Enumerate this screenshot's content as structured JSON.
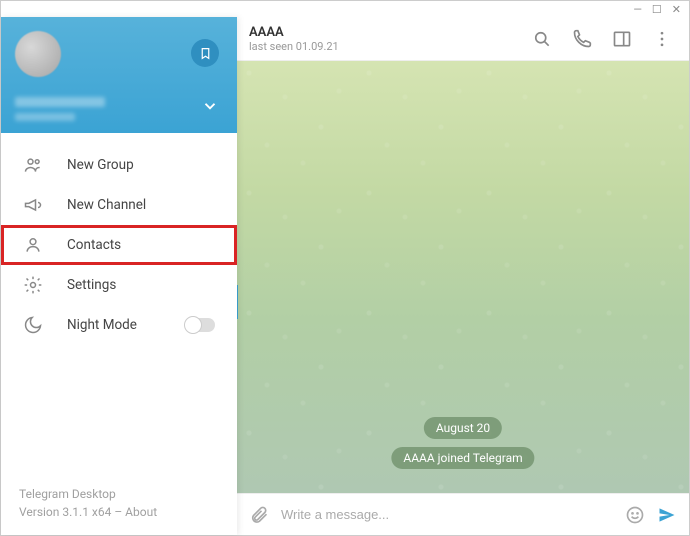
{
  "window": {
    "minimize": "—",
    "maximize": "☐",
    "close": "✕"
  },
  "profile": {
    "bookmark_icon": "bookmark",
    "expand_icon": "chevron-down"
  },
  "menu": {
    "new_group": "New Group",
    "new_channel": "New Channel",
    "contacts": "Contacts",
    "settings": "Settings",
    "night_mode": "Night Mode"
  },
  "footer": {
    "app_name": "Telegram Desktop",
    "version_line": "Version 3.1.1 x64 – About"
  },
  "chat": {
    "title": "AAAA",
    "last_seen": "last seen 01.09.21",
    "date_divider": "August 20",
    "system_message": "AAAA joined Telegram",
    "placeholder": "Write a message..."
  }
}
